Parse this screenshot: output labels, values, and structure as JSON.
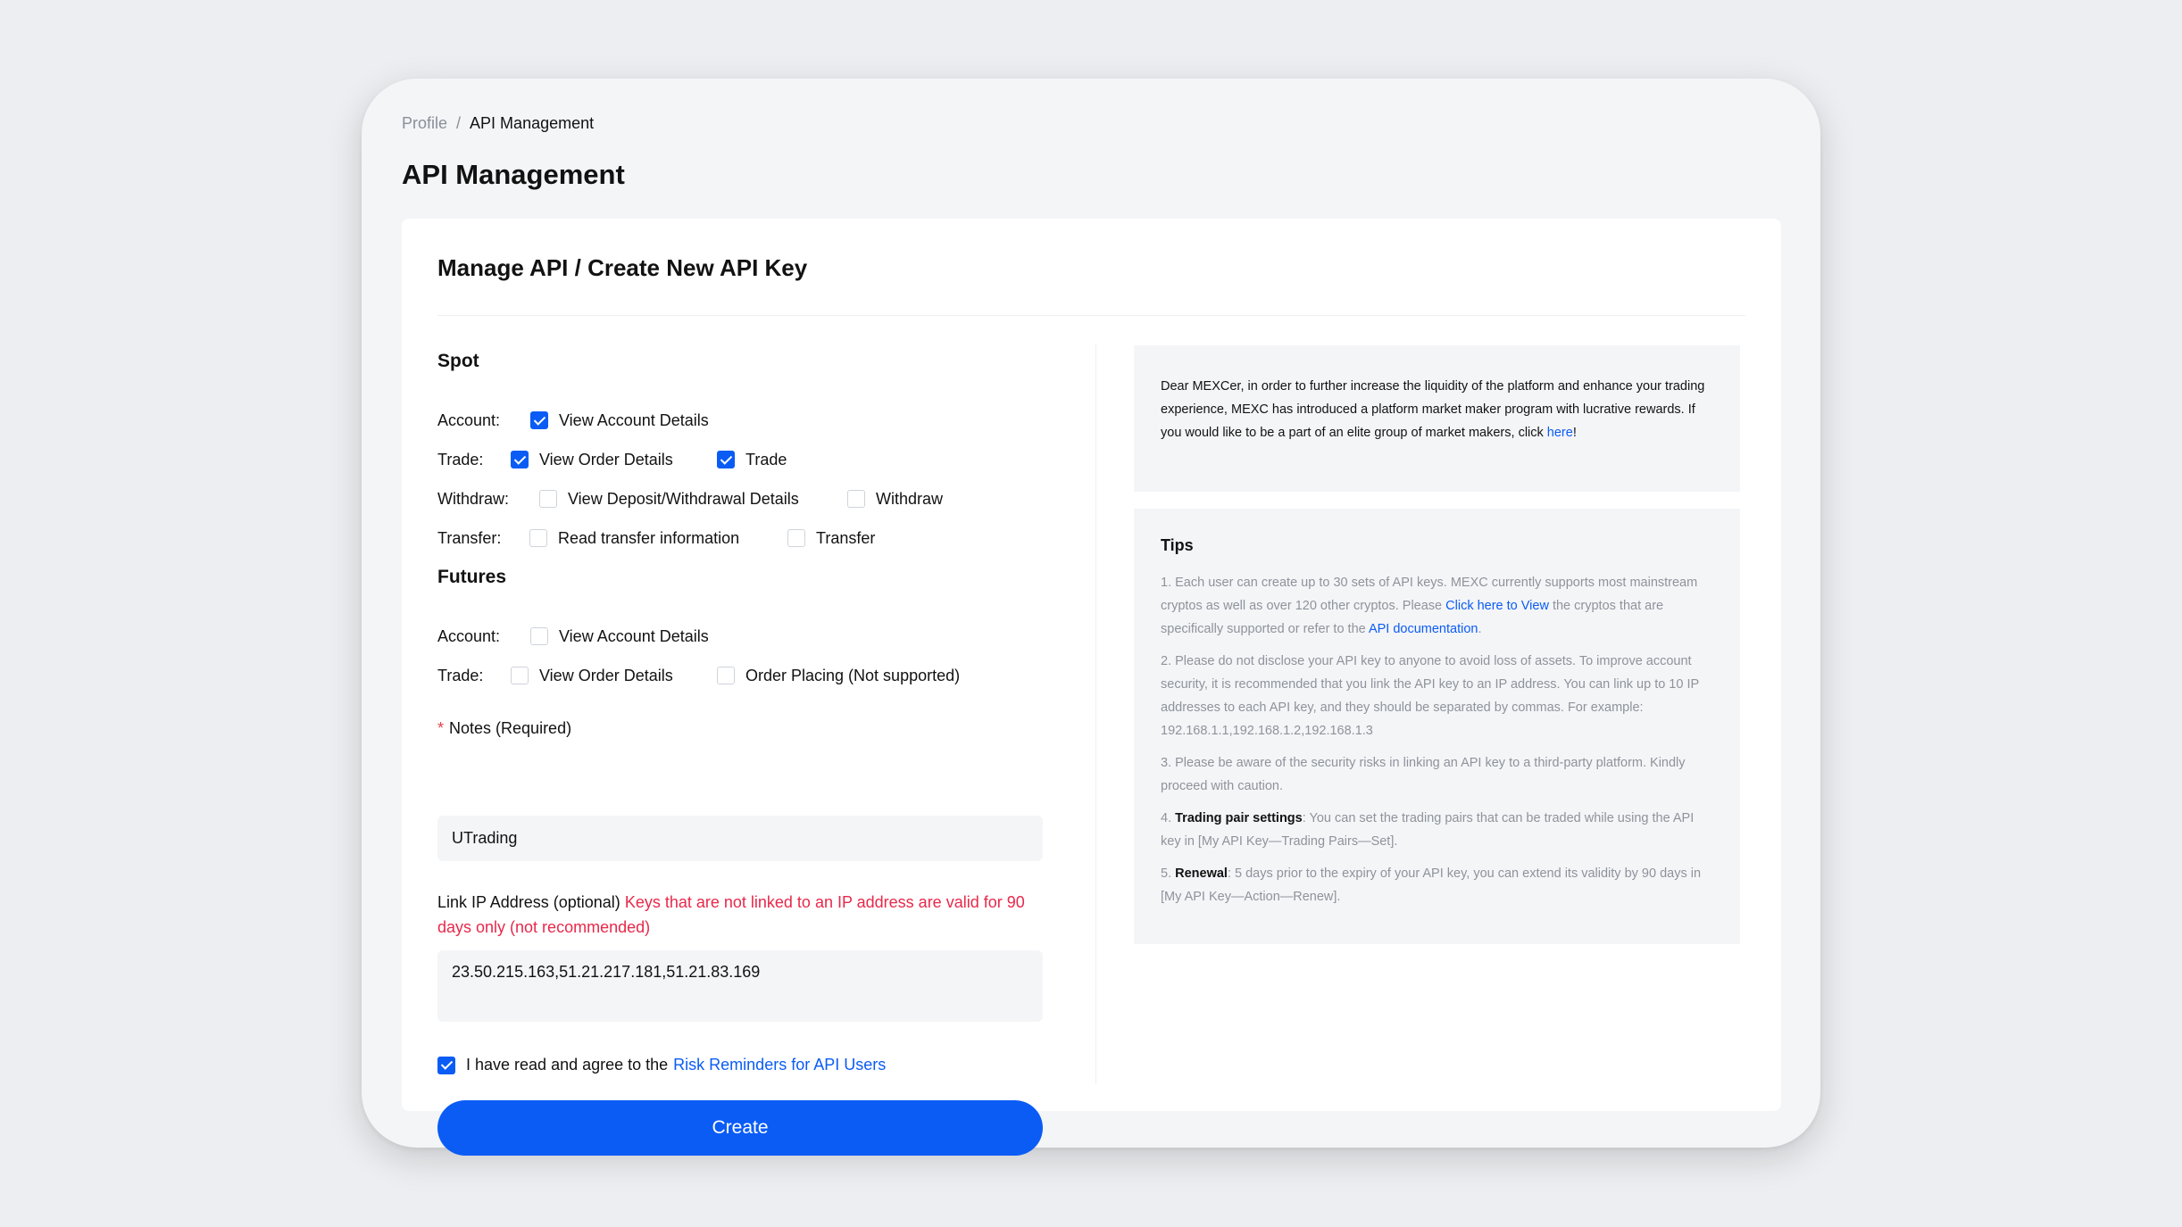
{
  "breadcrumb": {
    "parent": "Profile",
    "separator": "/",
    "current": "API Management"
  },
  "page_title": "API Management",
  "card_title": "Manage API / Create New API Key",
  "spot": {
    "title": "Spot",
    "account": {
      "label": "Account:",
      "opt1": "View Account Details"
    },
    "trade": {
      "label": "Trade:",
      "opt1": "View Order Details",
      "opt2": "Trade"
    },
    "withdraw": {
      "label": "Withdraw:",
      "opt1": "View Deposit/Withdrawal Details",
      "opt2": "Withdraw"
    },
    "transfer": {
      "label": "Transfer:",
      "opt1": "Read transfer information",
      "opt2": "Transfer"
    }
  },
  "futures": {
    "title": "Futures",
    "account": {
      "label": "Account:",
      "opt1": "View Account Details"
    },
    "trade": {
      "label": "Trade:",
      "opt1": "View Order Details",
      "opt2": "Order Placing (Not supported)"
    }
  },
  "notes": {
    "star": "*",
    "label": "Notes (Required)",
    "value": "UTrading"
  },
  "ip": {
    "label": "Link IP Address (optional)",
    "warning": "Keys that are not linked to an IP address are valid for 90 days only (not recommended)",
    "value": "23.50.215.163,51.21.217.181,51.21.83.169"
  },
  "agree": {
    "text": "I have read and agree to the",
    "link": "Risk Reminders for API Users"
  },
  "create_label": "Create",
  "promo": {
    "text": "Dear MEXCer, in order to further increase the liquidity of the platform and enhance your trading experience, MEXC has introduced a platform market maker program with lucrative rewards. If you would like to be a part of an elite group of market makers, click",
    "link": "here",
    "end": "!"
  },
  "tips": {
    "title": "Tips",
    "tip1_a": "1. Each user can create up to 30 sets of API keys. MEXC currently supports most mainstream cryptos as well as over 120 other cryptos. Please",
    "tip1_link1": "Click here to View",
    "tip1_b": "the cryptos that are specifically supported or refer to the",
    "tip1_link2": "API documentation",
    "tip1_c": ".",
    "tip2": "2. Please do not disclose your API key to anyone to avoid loss of assets. To improve account security, it is recommended that you link the API key to an IP address. You can link up to 10 IP addresses to each API key, and they should be separated by commas. For example: 192.168.1.1,192.168.1.2,192.168.1.3",
    "tip3": "3. Please be aware of the security risks in linking an API key to a third-party platform. Kindly proceed with caution.",
    "tip4_num": "4.",
    "tip4_bold": "Trading pair settings",
    "tip4_text": ": You can set the trading pairs that can be traded while using the API key in [My API Key—Trading Pairs—Set].",
    "tip5_num": "5.",
    "tip5_bold": "Renewal",
    "tip5_text": ": 5 days prior to the expiry of your API key, you can extend its validity by 90 days in [My API Key—Action—Renew]."
  },
  "state": {
    "spot_account_view": true,
    "spot_trade_view": true,
    "spot_trade_trade": true,
    "spot_withdraw_view": false,
    "spot_withdraw_withdraw": false,
    "spot_transfer_read": false,
    "spot_transfer_transfer": false,
    "futures_account_view": false,
    "futures_trade_view": false,
    "futures_trade_order": false,
    "agree": true
  },
  "colors": {
    "accent": "#0a5cf5",
    "warning": "#e8284a",
    "panel": "#f4f5f7"
  }
}
